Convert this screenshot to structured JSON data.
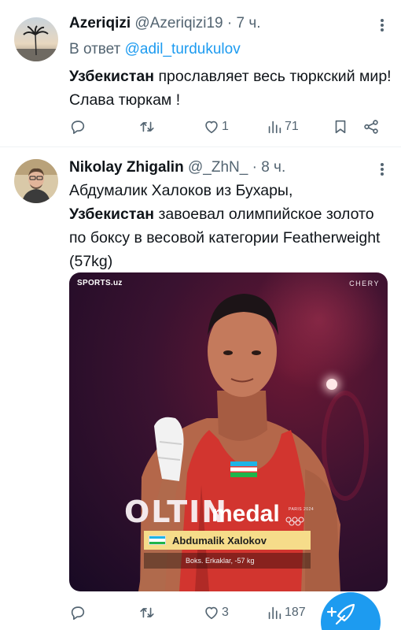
{
  "tweet1": {
    "name": "Azeriqizi",
    "handle": "@Azeriqizi19",
    "time": "7 ч.",
    "reply_prefix": "В ответ",
    "reply_to": "@adil_turdukulov",
    "text_bold": "Узбекистан",
    "text_rest": " прославляет весь тюркский мир! Слава тюркам !",
    "likes": "1",
    "views": "71"
  },
  "tweet2": {
    "name": "Nikolay Zhigalin",
    "handle": "@_ZhN_",
    "time": "8 ч.",
    "text_line1": "Абдумалик Халоков из Бухары,",
    "text_bold": "Узбекистан",
    "text_rest": " завоевал олимпийское золото по боксу в весовой категории Featherweight (57kg)",
    "media": {
      "brand_sports": "SPORTS.uz",
      "brand_chery": "CHERY",
      "oltin": "OLTIN",
      "medal": "medal",
      "paris": "PARIS 2024",
      "athlete": "Abdumalik Xalokov",
      "event": "Boks. Erkaklar, -57 kg"
    },
    "likes": "3",
    "views": "187"
  },
  "colors": {
    "accent": "#1d9bf0",
    "muted": "#536471",
    "text": "#0f1419",
    "gold_bar": "#f6dc8a"
  },
  "icons": [
    "more-icon",
    "reply-icon",
    "retweet-icon",
    "heart-icon",
    "views-icon",
    "bookmark-icon",
    "share-icon",
    "compose-icon"
  ]
}
